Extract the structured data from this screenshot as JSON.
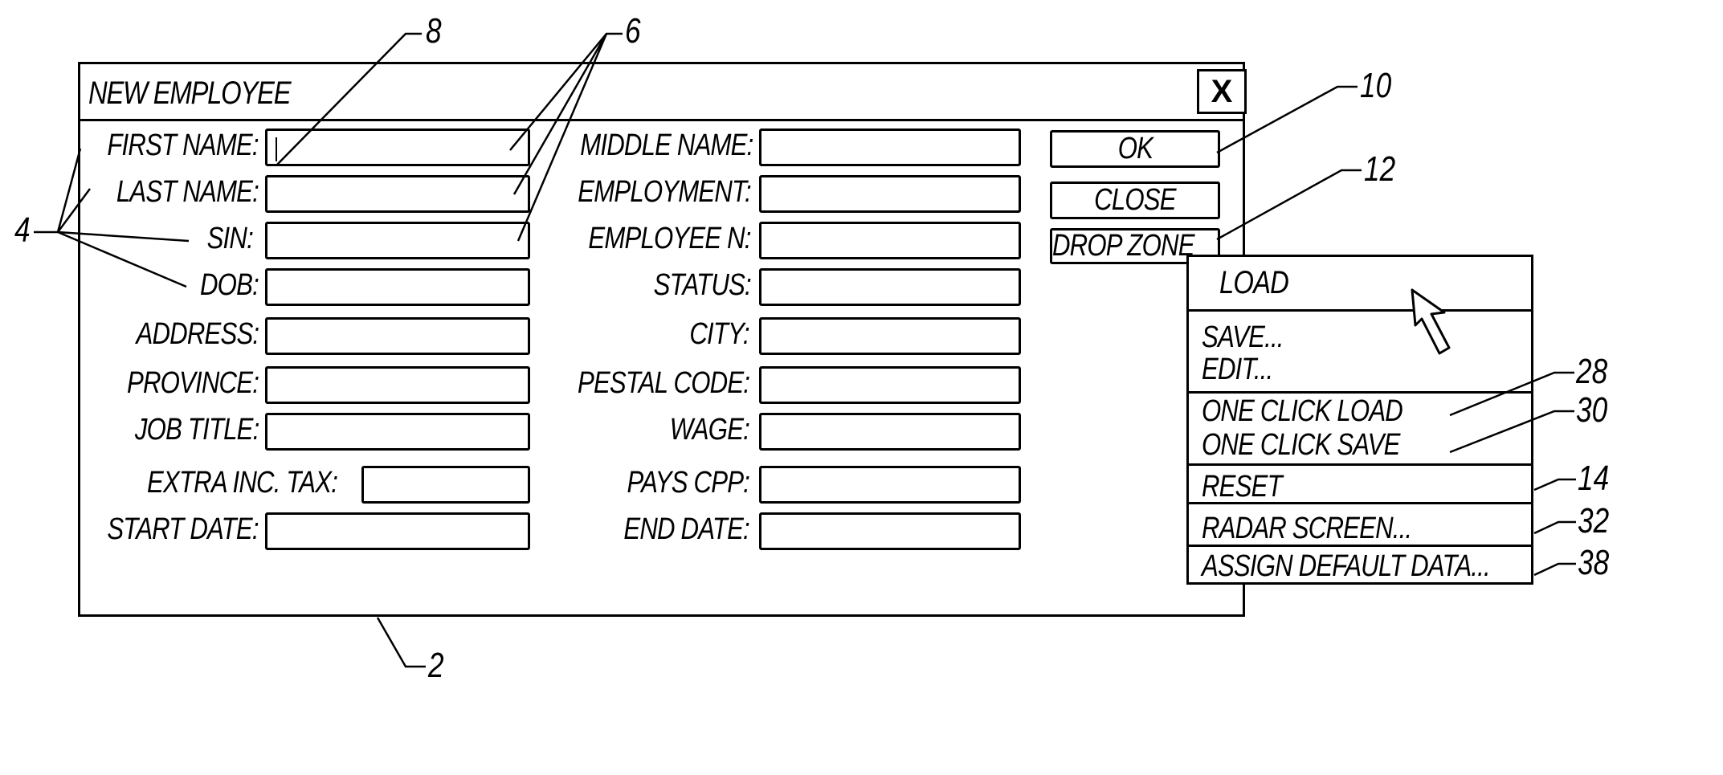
{
  "window": {
    "title": "NEW EMPLOYEE",
    "close_glyph": "X"
  },
  "form": {
    "left_fields": [
      {
        "label": "FIRST NAME:",
        "value": ""
      },
      {
        "label": "LAST NAME:",
        "value": ""
      },
      {
        "label": "SIN:",
        "value": ""
      },
      {
        "label": "DOB:",
        "value": ""
      },
      {
        "label": "ADDRESS:",
        "value": ""
      },
      {
        "label": "PROVINCE:",
        "value": ""
      },
      {
        "label": "JOB TITLE:",
        "value": ""
      },
      {
        "label": "EXTRA INC. TAX:",
        "value": ""
      },
      {
        "label": "START DATE:",
        "value": ""
      }
    ],
    "right_fields": [
      {
        "label": "MIDDLE NAME:",
        "value": ""
      },
      {
        "label": "EMPLOYMENT:",
        "value": ""
      },
      {
        "label": "EMPLOYEE N:",
        "value": ""
      },
      {
        "label": "STATUS:",
        "value": ""
      },
      {
        "label": "CITY:",
        "value": ""
      },
      {
        "label": "PESTAL CODE:",
        "value": ""
      },
      {
        "label": "WAGE:",
        "value": ""
      },
      {
        "label": "PAYS CPP:",
        "value": ""
      },
      {
        "label": "END DATE:",
        "value": ""
      }
    ]
  },
  "buttons": {
    "ok": "OK",
    "close": "CLOSE",
    "drop_zone": "DROP ZONE"
  },
  "context_menu": {
    "items": [
      {
        "label": "LOAD"
      },
      {
        "label": "SAVE..."
      },
      {
        "label": "EDIT..."
      },
      {
        "label": "ONE CLICK LOAD"
      },
      {
        "label": "ONE CLICK SAVE"
      },
      {
        "label": "RESET"
      },
      {
        "label": "RADAR SCREEN..."
      },
      {
        "label": "ASSIGN DEFAULT DATA..."
      }
    ],
    "cursor_icon": "arrow-pointer"
  },
  "reference_numerals": {
    "window": "2",
    "labels": "4",
    "fields": "6",
    "cursor": "8",
    "ok_button": "10",
    "drop_zone": "12",
    "reset": "14",
    "one_click_load": "28",
    "one_click_save": "30",
    "radar_screen": "32",
    "assign_default_data": "38"
  }
}
